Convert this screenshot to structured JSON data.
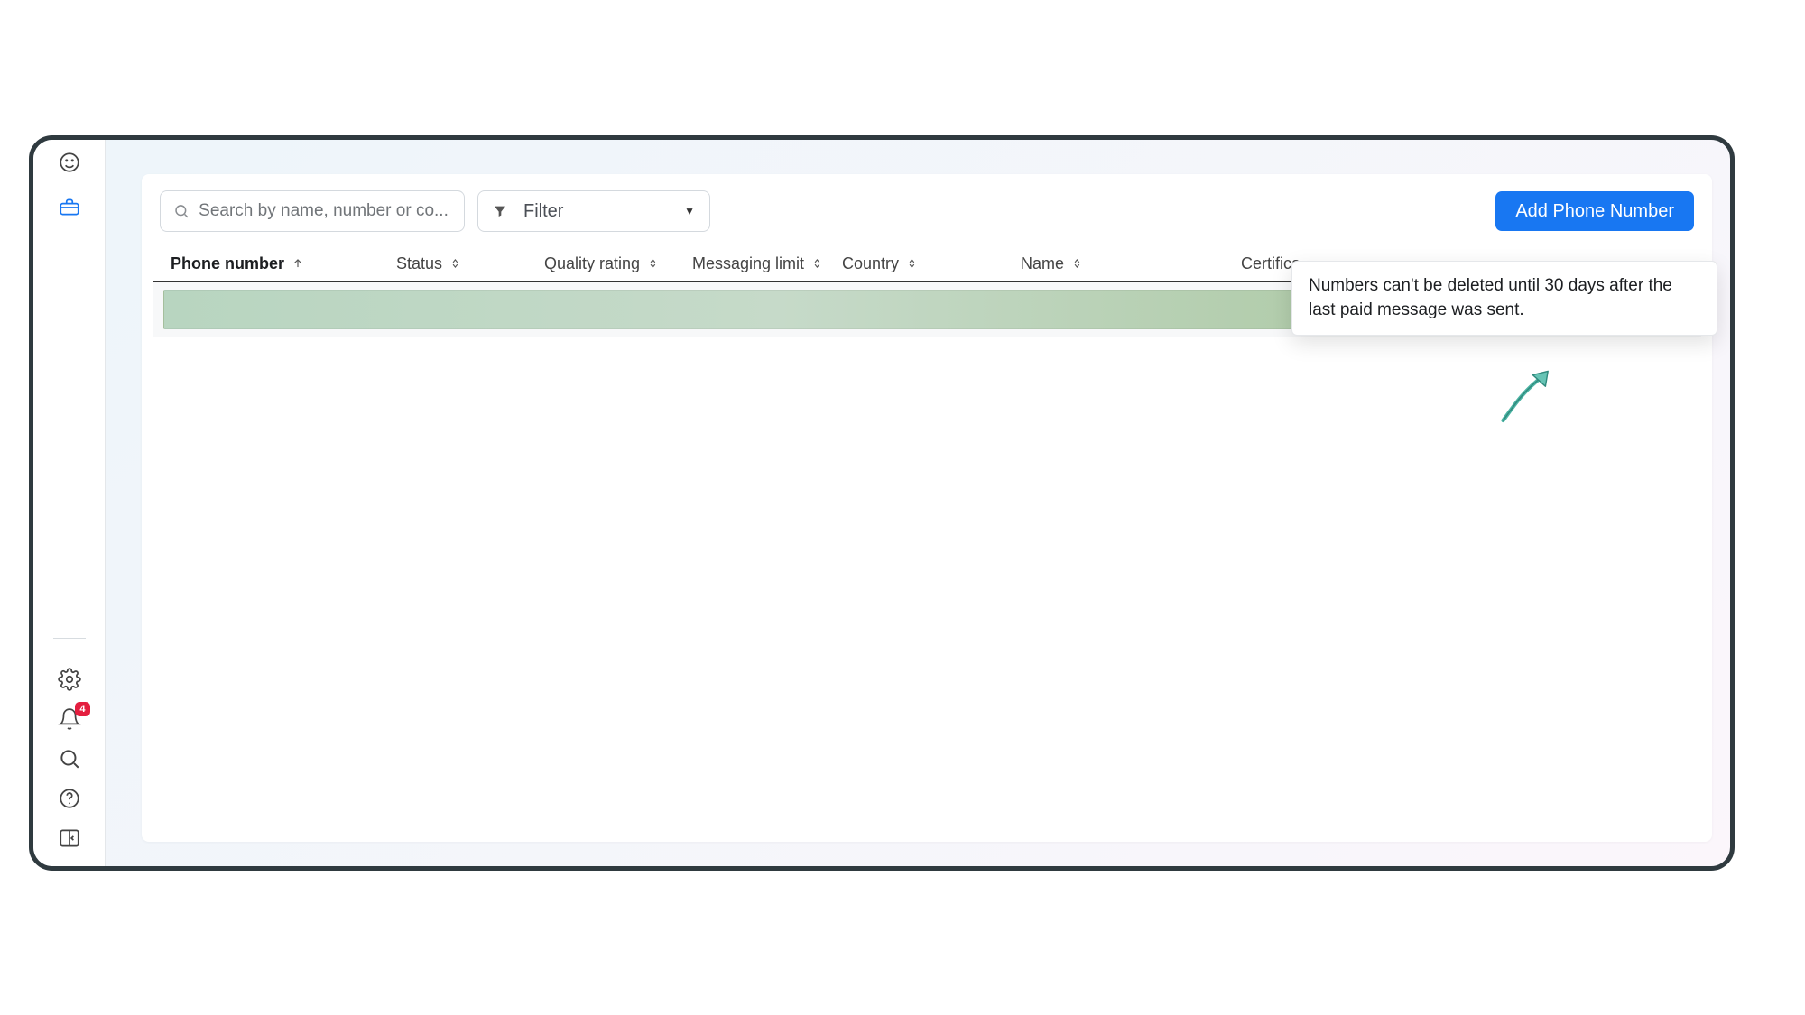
{
  "sidebar": {
    "nav_top": [
      "dashboard",
      "toolbox"
    ],
    "nav_bottom": [
      "settings",
      "notifications",
      "search",
      "help",
      "panel"
    ],
    "notification_badge": "4"
  },
  "toolbar": {
    "search_placeholder": "Search by name, number or co...",
    "filter_label": "Filter",
    "add_btn": "Add Phone Number"
  },
  "columns": [
    {
      "key": "phone",
      "label": "Phone number",
      "sort": "asc"
    },
    {
      "key": "status",
      "label": "Status",
      "sort": "both"
    },
    {
      "key": "quality",
      "label": "Quality rating",
      "sort": "both"
    },
    {
      "key": "msg",
      "label": "Messaging limit",
      "sort": "both"
    },
    {
      "key": "country",
      "label": "Country",
      "sort": "both"
    },
    {
      "key": "name",
      "label": "Name",
      "sort": "both"
    },
    {
      "key": "cert",
      "label": "Certifica",
      "sort": "none"
    }
  ],
  "tooltip": "Numbers can't be deleted until 30 days after the last paid message was sent.",
  "colors": {
    "primary": "#1877f2",
    "badge": "#e41e3f",
    "accent_arrow": "#4bb3a3"
  }
}
